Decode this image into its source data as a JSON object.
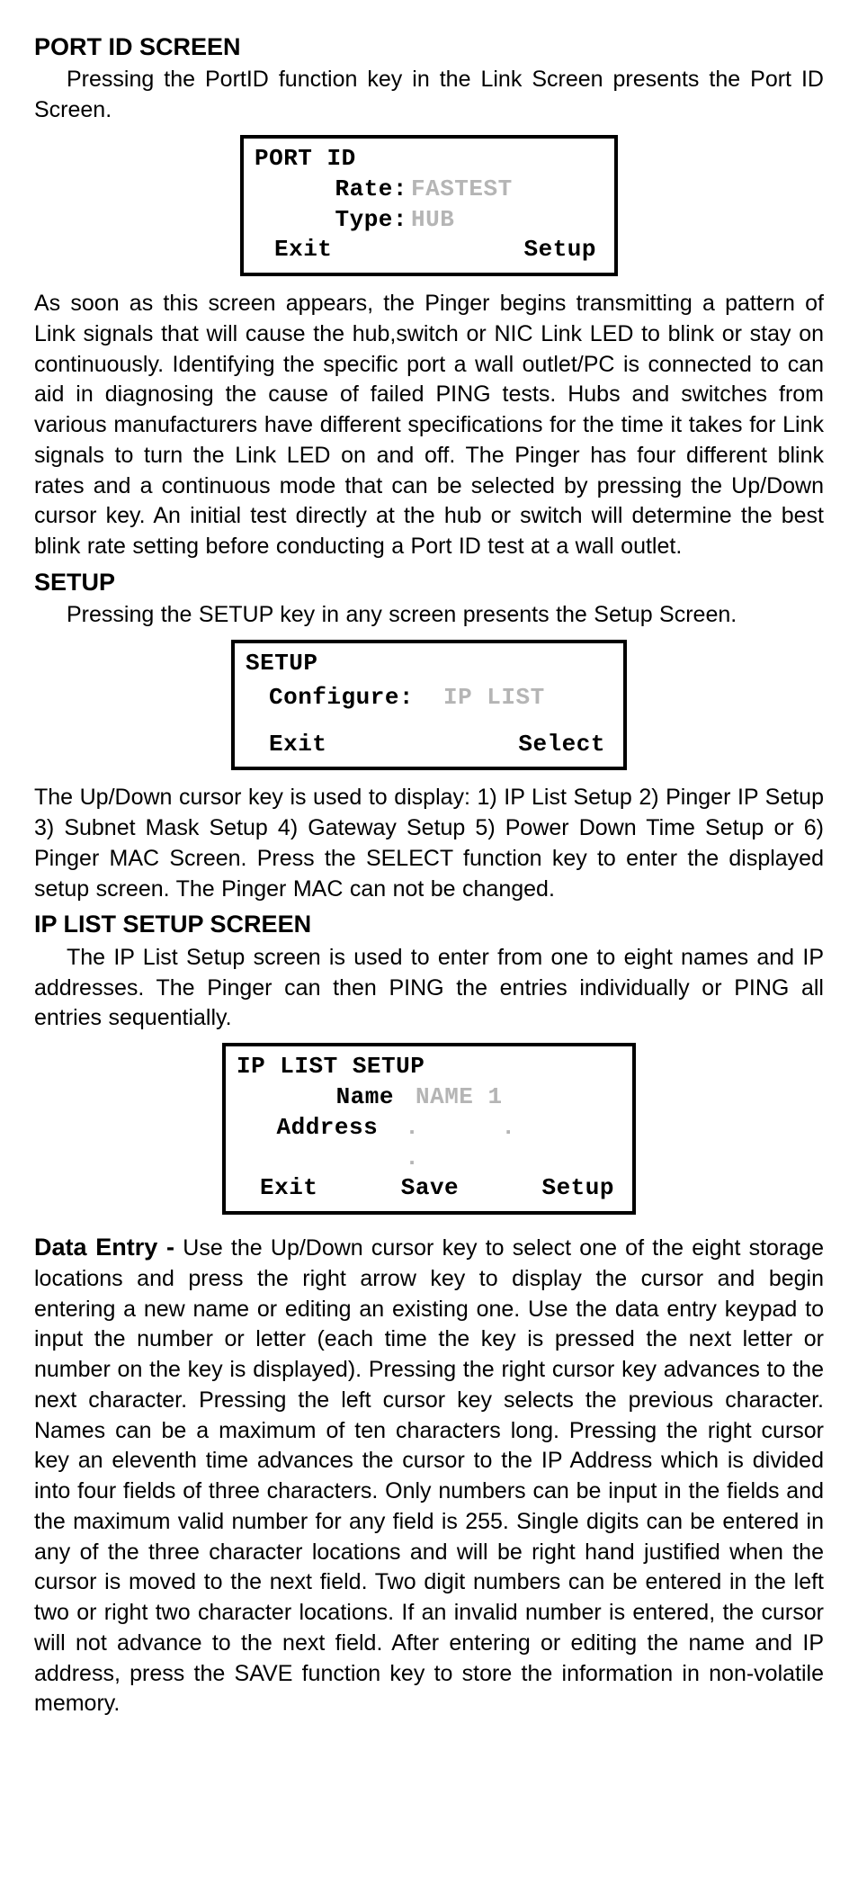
{
  "sections": {
    "portid": {
      "heading": "PORT ID SCREEN",
      "intro": "Pressing the PortID function key in the Link Screen presents the Port ID Screen.",
      "screen": {
        "title": "PORT ID",
        "rate_label": "Rate:",
        "rate_value": "FASTEST",
        "type_label": "Type:",
        "type_value": "HUB",
        "fn_left": "Exit",
        "fn_right": "Setup"
      },
      "body": "As soon as this screen appears, the Pinger begins transmitting a pattern of Link signals that will cause the hub,switch or NIC Link LED to blink or stay on continuously. Identifying the specific port a wall outlet/PC is connected to can aid in diagnosing the cause of failed PING tests. Hubs and switches from various manufacturers have different specifications for the time it takes for Link signals to turn the Link LED on and off. The Pinger has four different blink rates and a continuous mode that can be selected by pressing the Up/Down cursor key.  An initial test directly at the hub or switch will determine the best blink rate setting before conducting a Port ID test at a wall outlet."
    },
    "setup": {
      "heading": "SETUP",
      "intro": "Pressing the SETUP key in any screen presents the Setup Screen.",
      "screen": {
        "title": "SETUP",
        "configure_label": "Configure:",
        "configure_value": "IP LIST",
        "fn_left": "Exit",
        "fn_right": "Select"
      },
      "body": "The Up/Down cursor key is used to display: 1) IP List Setup 2) Pinger IP Setup 3) Subnet Mask Setup 4) Gateway Setup 5) Power Down Time Setup or 6) Pinger MAC Screen. Press the SELECT function key to enter the displayed setup screen. The Pinger MAC can not be changed."
    },
    "iplist": {
      "heading": "IP LIST SETUP SCREEN",
      "intro": "The IP List Setup screen is used to enter from one to eight names and IP addresses. The Pinger can then PING the entries individually or PING all entries sequentially.",
      "screen": {
        "title": "IP LIST SETUP",
        "name_label": "Name",
        "name_value": "NAME 1",
        "address_label": "Address",
        "address_value": "․․․",
        "fn_left": "Exit",
        "fn_mid": "Save",
        "fn_right": "Setup"
      }
    },
    "dataentry": {
      "label": "Data Entry -",
      "body": " Use the Up/Down cursor key to select one of the eight storage locations and press the right arrow key to display the cursor and begin entering a new name or editing an existing one. Use the data entry keypad to input the number or letter (each time the key is pressed the next letter or number on the key is displayed). Pressing the right cursor key advances to the next character. Pressing the left cursor key selects the previous character. Names can be a maximum of ten characters long. Pressing the right cursor key an eleventh time advances the cursor to the IP Address which is divided into four fields of three characters. Only numbers can be input in the fields and  the maximum valid number for any field is 255. Single digits can be entered in any of the three character locations and will be right hand justified when the cursor is moved to the next field. Two digit numbers can be entered in the left two or right two character locations. If an invalid number is entered, the cursor will not advance to the next field. After entering or editing the name and IP address, press the SAVE function key to store the information in non-volatile memory."
    }
  }
}
